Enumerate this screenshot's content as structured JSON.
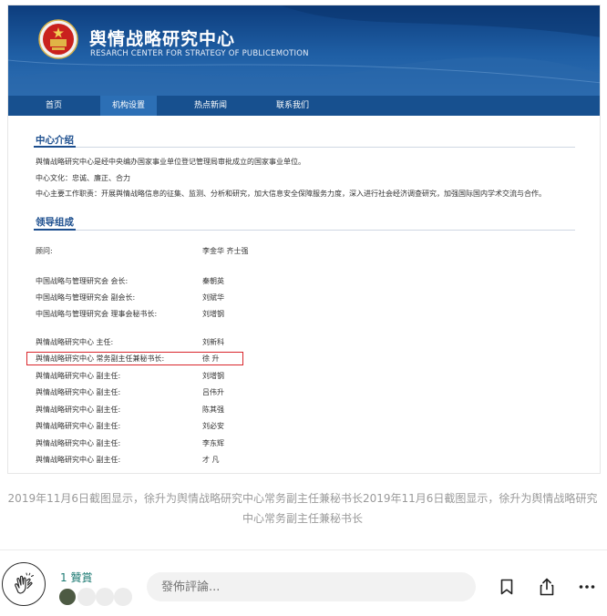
{
  "screenshot": {
    "site": {
      "title": "舆情战略研究中心",
      "subtitle": "RESARCH CENTER FOR STRATEGY OF PUBLICEMOTION",
      "emblem_icon": "national-emblem-icon"
    },
    "nav": [
      {
        "label": "首页",
        "active": false
      },
      {
        "label": "机构设置",
        "active": true
      },
      {
        "label": "热点新闻",
        "active": false
      },
      {
        "label": "联系我们",
        "active": false
      }
    ],
    "intro": {
      "heading": "中心介绍",
      "lines": [
        "舆情战略研究中心是经中央编办国家事业单位登记管理局审批成立的国家事业单位。",
        "中心文化：忠诚、廉正、合力",
        "中心主要工作职责：开展舆情战略信息的征集、监测、分析和研究，加大信息安全保障服务力度，深入进行社会经济调查研究，加强国际国内学术交流与合作。"
      ]
    },
    "leadership": {
      "heading": "领导组成",
      "rows": [
        {
          "role": "顾问:",
          "name": "李金华   齐士强"
        },
        {
          "role": "中国战略与管理研究会  会长:",
          "name": "秦朝英"
        },
        {
          "role": "中国战略与管理研究会  副会长:",
          "name": "刘斌华"
        },
        {
          "role": "中国战略与管理研究会  理事会秘书长:",
          "name": "刘增钢"
        },
        {
          "role": "舆情战略研究中心  主任:",
          "name": "刘新科"
        },
        {
          "role": "舆情战略研究中心  常务副主任兼秘书长:",
          "name": "徐 升"
        },
        {
          "role": "舆情战略研究中心  副主任:",
          "name": "刘增钢"
        },
        {
          "role": "舆情战略研究中心  副主任:",
          "name": "吕伟升"
        },
        {
          "role": "舆情战略研究中心  副主任:",
          "name": "陈其强"
        },
        {
          "role": "舆情战略研究中心  副主任:",
          "name": "刘必安"
        },
        {
          "role": "舆情战略研究中心  副主任:",
          "name": "李东辉"
        },
        {
          "role": "舆情战略研究中心  副主任:",
          "name": "才 凡"
        }
      ],
      "highlight_color": "#d9262c"
    }
  },
  "caption": "2019年11月6日截图显示，徐升为舆情战略研究中心常务副主任兼秘书长2019年11月6日截图显示，徐升为舆情战略研究中心常务副主任兼秘书长",
  "footer": {
    "clap_icon": "clap-hands-icon",
    "clap_count": "1 贊賞",
    "comment_placeholder": "發佈評論...",
    "bookmark_icon": "bookmark-icon",
    "share_icon": "share-icon",
    "more_icon": "more-dots-icon",
    "accent_color": "#1d7a73"
  }
}
